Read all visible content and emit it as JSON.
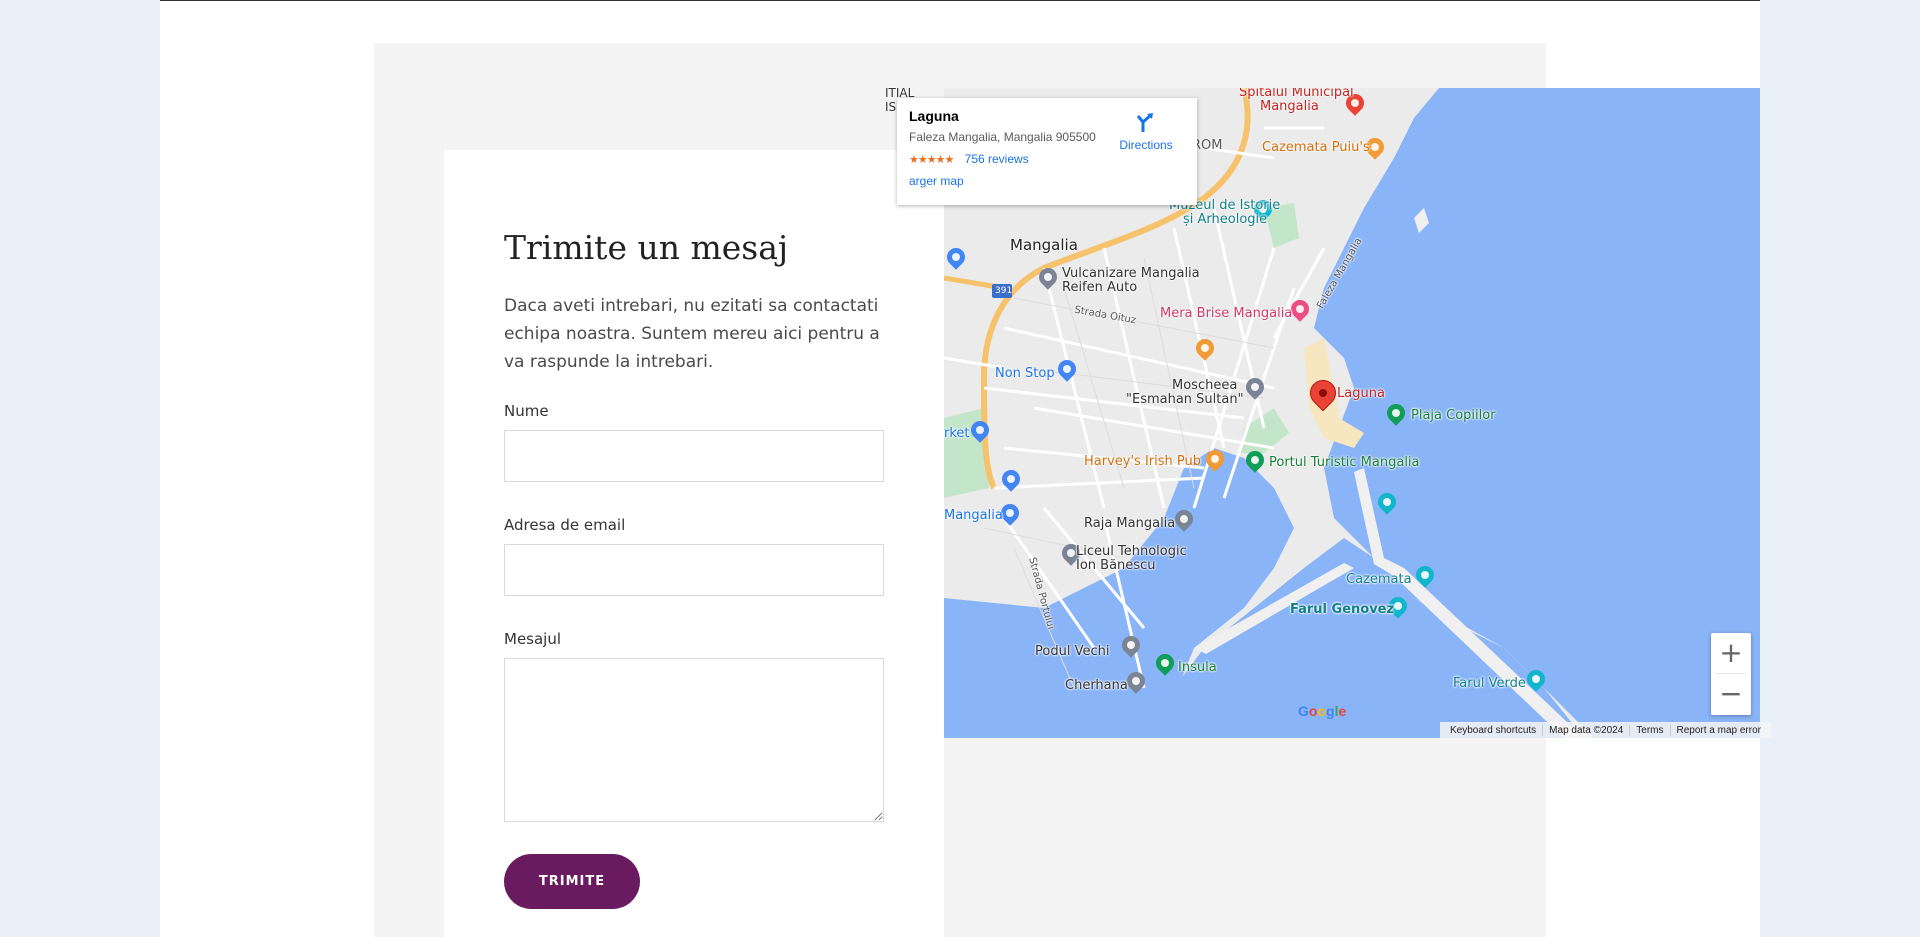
{
  "form": {
    "title": "Trimite un mesaj",
    "description": "Daca aveti intrebari, nu ezitati sa contactati echipa noastra. Suntem mereu aici pentru a va raspunde la intrebari.",
    "name_label": "Nume",
    "email_label": "Adresa de email",
    "message_label": "Mesajul",
    "name_value": "",
    "email_value": "",
    "message_value": "",
    "submit_label": "TRIMITE"
  },
  "map": {
    "place_name": "Laguna",
    "address": "Faleza Mangalia, Mangalia 905500",
    "rating_stars": "★★★★★",
    "reviews": "756 reviews",
    "larger_map_link": "arger map",
    "directions_label": "Directions",
    "zoom_in": "+",
    "zoom_out": "−",
    "attribution": {
      "keyboard": "Keyboard shortcuts",
      "map_data": "Map data ©2024",
      "terms": "Terms",
      "report": "Report a map error"
    },
    "labels": {
      "spitalul": "Spitalul Municipal",
      "spitalul2": "Mangalia",
      "cazemata_puiu": "Cazemata Puiu's",
      "muzeul": "Muzeul de Istorie",
      "muzeul2": "și Arheologie",
      "mangalia_city": "Mangalia",
      "vulcanizare": "Vulcanizare Mangalia",
      "vulcanizare2": "Reifen Auto",
      "road_391": "391",
      "strada_oituz": "Strada Oituz",
      "faleza_mangalia": "Faleza Mangalia",
      "mera_brise": "Mera Brise Mangalia",
      "non_stop": "Non Stop",
      "moscheea": "Moscheea",
      "moscheea2": "\"Esmahan Sultan\"",
      "laguna": "Laguna",
      "plaja_copiilor": "Plaja Copiilor",
      "rket": "rket",
      "harveys": "Harvey's Irish Pub",
      "portul": "Portul Turistic Mangalia",
      "mangalia_left": "Mangalia",
      "raja": "Raja Mangalia",
      "liceul": "Liceul Tehnologic",
      "liceul2": "Ion Bănescu",
      "strada_portului": "Strada Portului",
      "cazemata": "Cazemata",
      "farul_genovez": "Farul Genovez",
      "podul_vechi": "Podul Vechi",
      "insula": "Insula",
      "cherhana": "Cherhana",
      "farul_verde": "Farul Verde",
      "trom": "TROM",
      "itial": "ITIAL",
      "is": "IS"
    },
    "colors": {
      "water": "#8ab4f8",
      "land": "#ebebeb",
      "road_major": "#f6c26b",
      "beach": "#f6e7c1",
      "park": "#c3e6cb"
    }
  },
  "google_logo": "Google"
}
